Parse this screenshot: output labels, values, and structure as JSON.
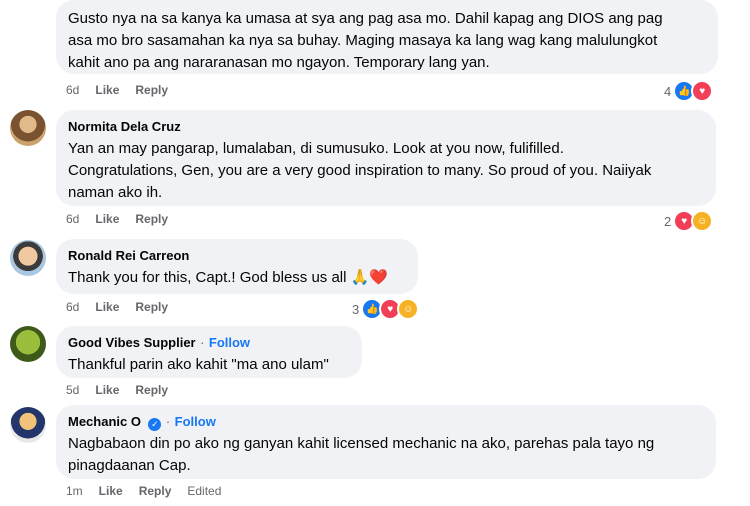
{
  "comments": [
    {
      "author": "",
      "lines": [
        "Gusto nya na sa kanya ka umasa at sya ang pag asa mo. Dahil kapag ang DIOS ang pag",
        "asa mo bro sasamahan ka nya sa buhay. Maging masaya ka lang wag kang malulungkot",
        "kahit ano pa ang nararanasan mo ngayon. Temporary lang yan."
      ],
      "time": "6d",
      "like": "Like",
      "reply": "Reply",
      "react_count": "4",
      "reactions": [
        "like-icon",
        "love-icon"
      ]
    },
    {
      "author": "Normita Dela Cruz",
      "lines": [
        "Yan an may pangarap, lumalaban, di sumusuko. Look at you now, fulifilled.",
        "Congratulations, Gen, you are a very good inspiration to many. So proud of you. Naiiyak",
        "naman ako ih."
      ],
      "time": "6d",
      "like": "Like",
      "reply": "Reply",
      "react_count": "2",
      "reactions": [
        "love-icon",
        "care-icon"
      ]
    },
    {
      "author": "Ronald Rei Carreon",
      "lines": [
        "Thank you for this, Capt.! God bless us all 🙏❤️"
      ],
      "time": "6d",
      "like": "Like",
      "reply": "Reply",
      "react_count": "3",
      "reactions": [
        "like-icon",
        "love-icon",
        "care-icon"
      ]
    },
    {
      "author": "Good Vibes Supplier",
      "separator": "·",
      "follow": "Follow",
      "lines": [
        "Thankful parin ako kahit \"ma ano ulam\""
      ],
      "time": "5d",
      "like": "Like",
      "reply": "Reply"
    },
    {
      "author": "Mechanic O",
      "separator": "·",
      "follow": "Follow",
      "verified": true,
      "lines": [
        "Nagbabaon din po ako ng ganyan kahit licensed mechanic na ako, parehas pala tayo ng",
        "pinagdaanan Cap."
      ],
      "time": "1m",
      "like": "Like",
      "reply": "Reply",
      "edited": "Edited"
    }
  ],
  "colors": {
    "bubble": "#f0f2f5",
    "meta": "#65676b",
    "link": "#1877f2"
  }
}
